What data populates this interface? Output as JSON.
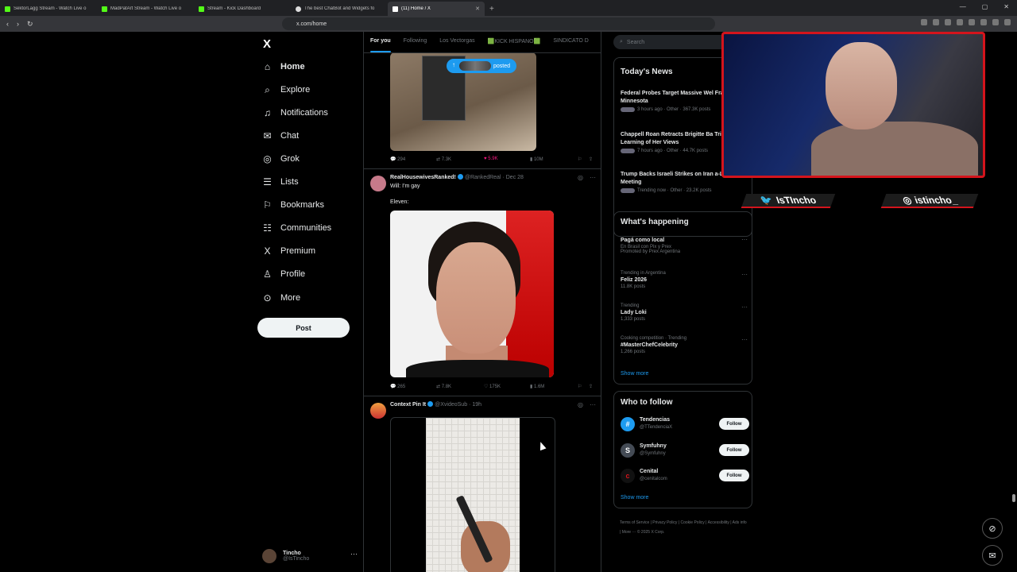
{
  "browser": {
    "tabs": [
      {
        "title": "SektorLagg Stream - Watch Live o",
        "color": "#53fc18"
      },
      {
        "title": "MadPatArt Stream - Watch Live o",
        "color": "#53fc18"
      },
      {
        "title": "Stream - Kick Dashboard",
        "color": "#53fc18"
      },
      {
        "title": "The best ChatBot and Widgets fo",
        "color": "#dddddd"
      },
      {
        "title": "(11) Home / X",
        "color": "#ffffff"
      }
    ],
    "url": "x.com/home"
  },
  "sidebar": {
    "logo": "X",
    "items": [
      {
        "label": "Home",
        "icon": "⌂"
      },
      {
        "label": "Explore",
        "icon": "⌕"
      },
      {
        "label": "Notifications",
        "icon": "♫"
      },
      {
        "label": "Chat",
        "icon": "✉"
      },
      {
        "label": "Grok",
        "icon": "◎"
      },
      {
        "label": "Lists",
        "icon": "☰"
      },
      {
        "label": "Bookmarks",
        "icon": "⚐"
      },
      {
        "label": "Communities",
        "icon": "☷"
      },
      {
        "label": "Premium",
        "icon": "X"
      },
      {
        "label": "Profile",
        "icon": "♙"
      },
      {
        "label": "More",
        "icon": "⊙"
      }
    ],
    "post_label": "Post",
    "account": {
      "name": "Tincho",
      "handle": "@IsTincho"
    }
  },
  "feed": {
    "tabs": [
      "For you",
      "Following",
      "Los Vectorgas",
      "🟩KICK HISPANO🟩",
      "SINDICATO D"
    ],
    "posted_pill": "posted",
    "post1_actions": {
      "replies": "294",
      "reposts": "7.3K",
      "likes": "5.9K",
      "views": "10M"
    },
    "tweet2": {
      "name": "RealHousewivesRanked!",
      "handle": "@RankedReal",
      "time": "Dec 28",
      "text1": "Will: I'm gay",
      "text2": "Eleven:",
      "actions": {
        "replies": "265",
        "reposts": "7.8K",
        "likes": "175K",
        "views": "1.6M"
      }
    },
    "tweet3": {
      "name": "Context Pin It",
      "handle": "@XvideoSub",
      "time": "19h"
    }
  },
  "right": {
    "search_placeholder": "Search",
    "todays_news_title": "Today's News",
    "news": [
      {
        "title": "Federal Probes Target Massive Wel Fraud in Minnesota",
        "meta": "3 hours ago · Other · 367.3K posts"
      },
      {
        "title": "Chappell Roan Retracts Brigitte Ba Tribute After Learning of Her Views",
        "meta": "7 hours ago · Other · 44.7K posts"
      },
      {
        "title": "Trump Backs Israeli Strikes on Iran a-Lago Meeting",
        "meta": "Trending now · Other · 23.2K posts"
      }
    ],
    "happening_title": "What's happening",
    "trends": [
      {
        "context": "",
        "title": "Pagá como local",
        "sub": "En Brasil con Pix y Prex",
        "extra": "Promoted by Prex Argentina"
      },
      {
        "context": "Trending in Argentina",
        "title": "Feliz 2026",
        "sub": "11.8K posts",
        "extra": ""
      },
      {
        "context": "Trending",
        "title": "Lady Loki",
        "sub": "1,333 posts",
        "extra": ""
      },
      {
        "context": "Cooking competition · Trending",
        "title": "#MasterChefCelebrity",
        "sub": "1,266 posts",
        "extra": ""
      }
    ],
    "show_more": "Show more",
    "who_to_follow_title": "Who to follow",
    "follow": [
      {
        "name": "Tendencias",
        "handle": "@TTendenciaX",
        "avatar": "#",
        "color": "#1d9bf0"
      },
      {
        "name": "Symfuhny",
        "handle": "@Symfuhny",
        "avatar": "S",
        "color": "#444b55"
      },
      {
        "name": "Cenital",
        "handle": "@cenitalcom",
        "avatar": "c",
        "color": "#111111"
      }
    ],
    "follow_label": "Follow",
    "footer": "Terms of Service | Privacy Policy | Cookie Policy | Accessibility | Ads info | More ··· © 2025 X Corp."
  },
  "overlay": {
    "twitter_handle": "IsTIncho",
    "instagram_handle": "istincho_",
    "accent": "#d4141c"
  }
}
